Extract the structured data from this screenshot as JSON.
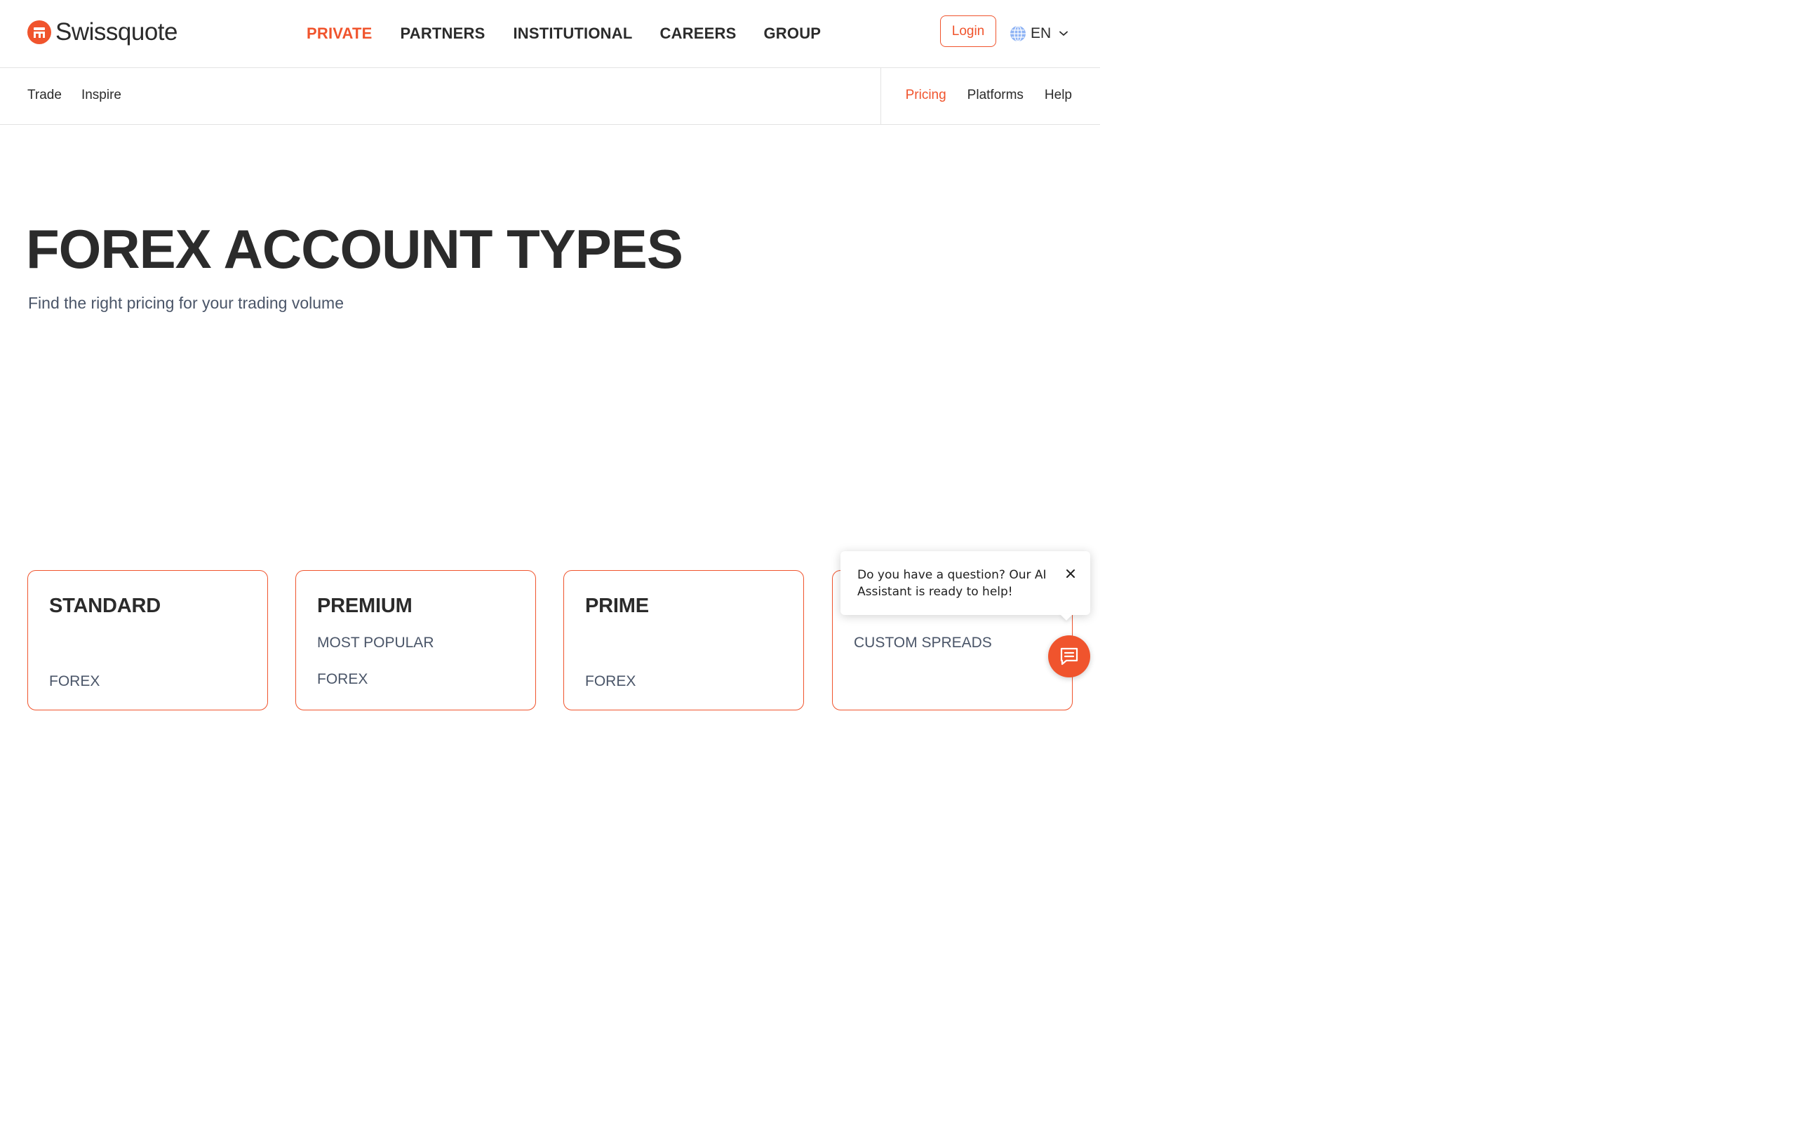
{
  "brand": {
    "name": "Swissquote",
    "accent_color": "#f0542d",
    "logo_icon": "swissquote-logo-icon"
  },
  "main_nav": {
    "items": [
      {
        "label": "PRIVATE",
        "active": true
      },
      {
        "label": "PARTNERS",
        "active": false
      },
      {
        "label": "INSTITUTIONAL",
        "active": false
      },
      {
        "label": "CAREERS",
        "active": false
      },
      {
        "label": "GROUP",
        "active": false
      }
    ]
  },
  "header": {
    "login_label": "Login",
    "language": "EN",
    "language_icon": "globe-icon",
    "language_dropdown_icon": "chevron-down-icon"
  },
  "sub_nav": {
    "left": [
      {
        "label": "Trade"
      },
      {
        "label": "Inspire"
      }
    ],
    "right": [
      {
        "label": "Pricing",
        "active": true
      },
      {
        "label": "Platforms",
        "active": false
      },
      {
        "label": "Help",
        "active": false
      }
    ]
  },
  "hero": {
    "title": "FOREX ACCOUNT TYPES",
    "subtitle": "Find the right pricing for your trading volume"
  },
  "cards": [
    {
      "title": "STANDARD",
      "tag": "",
      "label": "FOREX"
    },
    {
      "title": "PREMIUM",
      "tag": "MOST POPULAR",
      "label": "FOREX"
    },
    {
      "title": "PRIME",
      "tag": "",
      "label": "FOREX"
    },
    {
      "title": "",
      "tag": "CUSTOM SPREADS",
      "label": ""
    }
  ],
  "chat": {
    "message": "Do you have a question? Our AI Assistant is ready to help!",
    "close_icon": "close-icon",
    "open_icon": "chat-icon"
  }
}
